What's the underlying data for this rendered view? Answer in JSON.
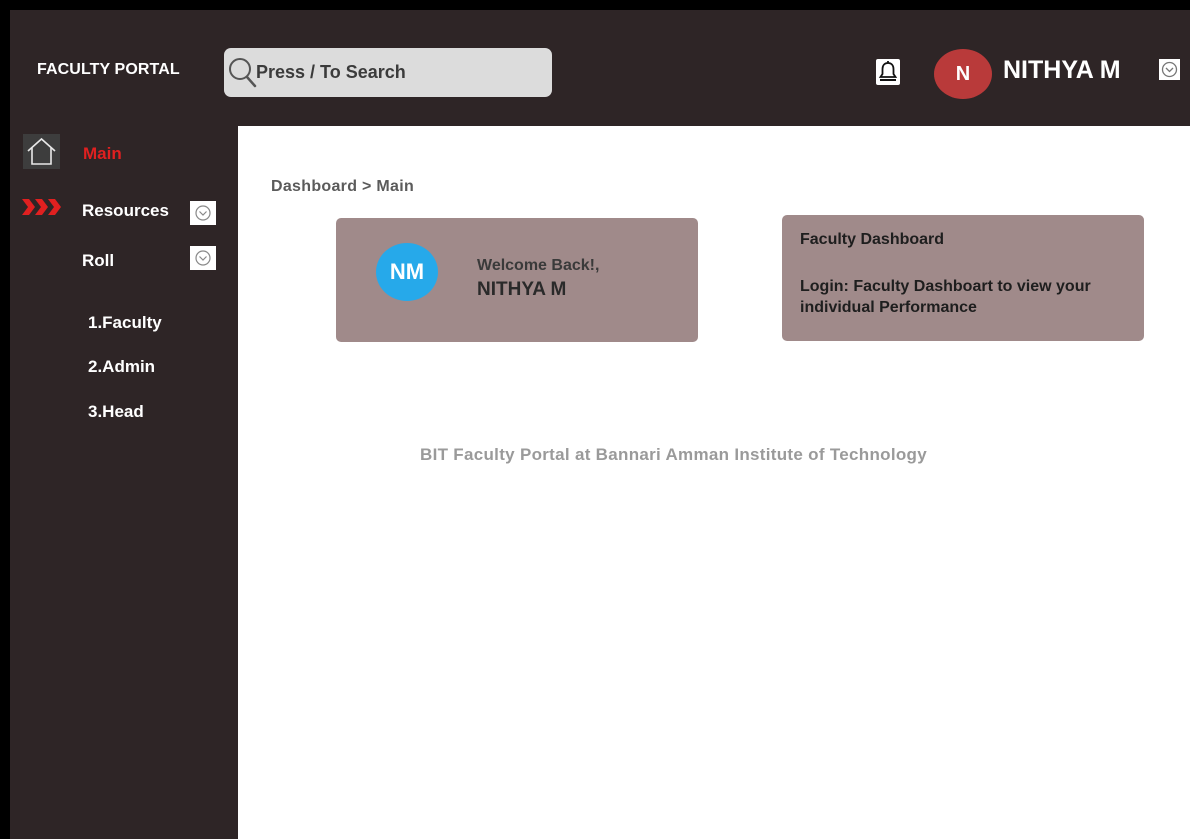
{
  "header": {
    "brand": "FACULTY PORTAL",
    "search_placeholder": "Press / To Search",
    "avatar_initial": "N",
    "user_name": "NITHYA M"
  },
  "sidebar": {
    "items": [
      {
        "label": "Main",
        "icon": "home-icon",
        "active": true
      },
      {
        "label": "Resources",
        "icon": "arrows-icon",
        "has_dropdown": true
      },
      {
        "label": "Roll",
        "has_dropdown": true
      }
    ],
    "roll_subitems": [
      "1.Faculty",
      "2.Admin",
      "3.Head"
    ]
  },
  "breadcrumb": "Dashboard  >  Main",
  "welcome_card": {
    "initials": "NM",
    "greeting": "Welcome Back!,",
    "name": "NITHYA M"
  },
  "faculty_card": {
    "title": "Faculty Dashboard",
    "description": "Login: Faculty Dashboart to view your  individual  Performance"
  },
  "footer": "BIT  Faculty  Portal  at  Bannari Amman  Institute  of  Technology",
  "colors": {
    "chrome": "#2e2526",
    "accent_red": "#e02020",
    "avatar_red": "#b93a3a",
    "avatar_blue": "#26a9ea",
    "card": "#a08a8a"
  }
}
